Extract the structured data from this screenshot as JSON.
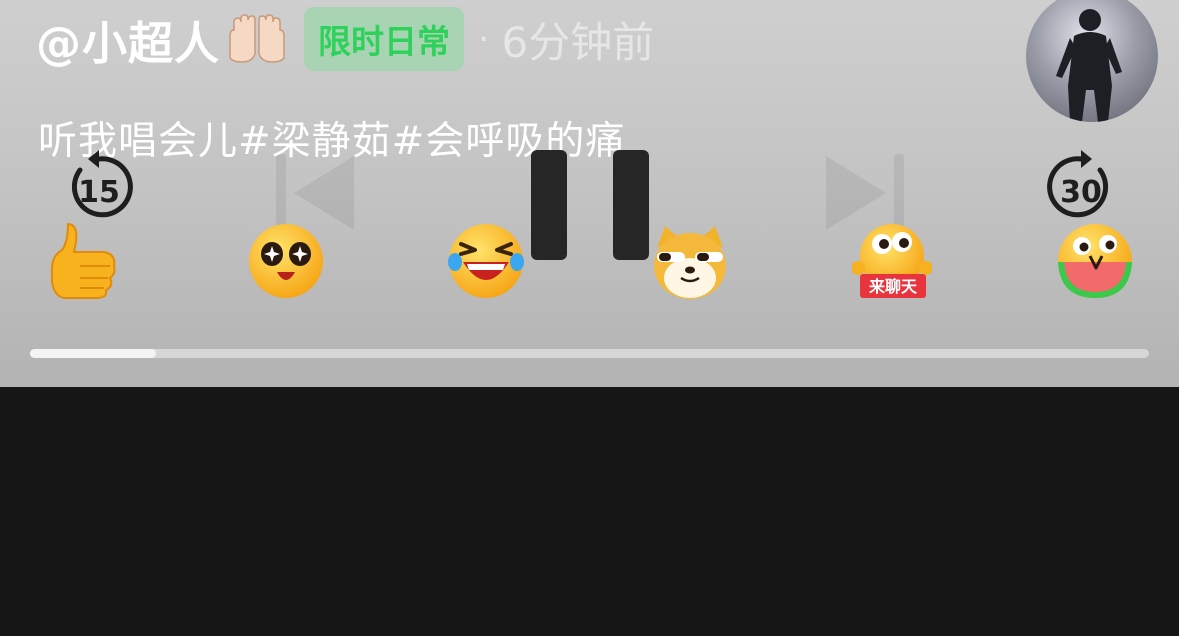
{
  "header": {
    "username": "@小超人",
    "username_emoji": "raised-hands-emoji",
    "tag": "限时日常",
    "separator": "·",
    "time_ago": "6分钟前"
  },
  "caption": "听我唱会儿#梁静茹#会呼吸的痛",
  "controls": {
    "rewind_seconds": "15",
    "forward_seconds": "30",
    "icons": [
      "rewind-15-icon",
      "previous-icon",
      "pause-icon",
      "next-icon",
      "forward-30-icon"
    ]
  },
  "reactions": {
    "items": [
      "thumbs-up-emoji",
      "starry-eyes-emoji",
      "laugh-cry-emoji",
      "doge-emoji",
      "lets-chat-emoji",
      "watermelon-emoji"
    ],
    "chat_label": "来聊天"
  },
  "progress": {
    "fraction": 0.113
  },
  "colors": {
    "tag_bg": "#a9d4b4",
    "tag_text": "#2ed25a",
    "background": "#161616"
  }
}
